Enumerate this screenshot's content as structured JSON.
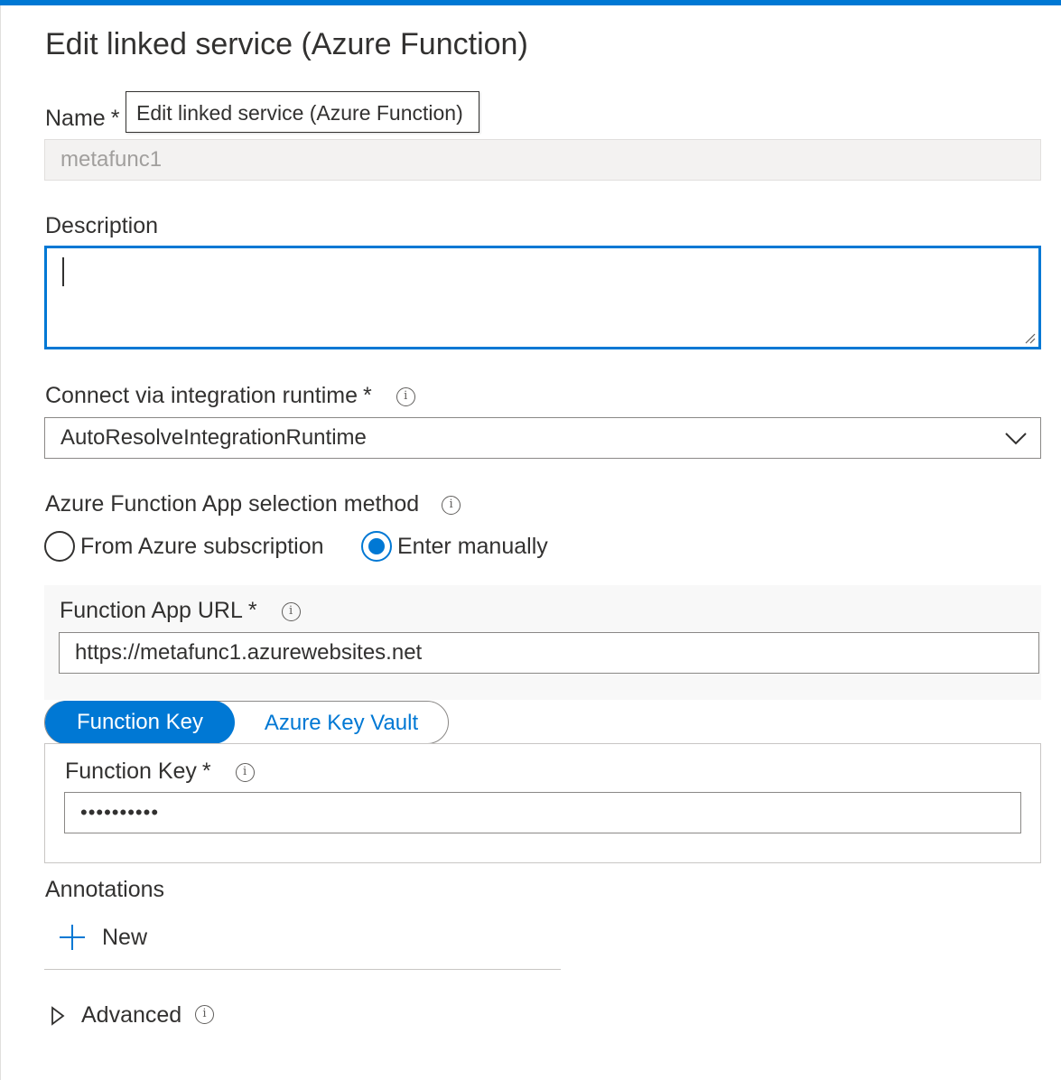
{
  "dialog": {
    "title": "Edit linked service (Azure Function)",
    "tooltip": "Edit linked service (Azure Function)"
  },
  "name": {
    "label": "Name",
    "required": "*",
    "value": "metafunc1"
  },
  "description": {
    "label": "Description",
    "value": ""
  },
  "runtime": {
    "label": "Connect via integration runtime",
    "required": "*",
    "selected": "AutoResolveIntegrationRuntime",
    "info_icon": "info-icon"
  },
  "selection_method": {
    "label": "Azure Function App selection method",
    "options": [
      {
        "label": "From Azure subscription",
        "checked": false
      },
      {
        "label": "Enter manually",
        "checked": true
      }
    ]
  },
  "function_app_url": {
    "label": "Function App URL",
    "required": "*",
    "value": "https://metafunc1.azurewebsites.net"
  },
  "auth_toggle": {
    "options": [
      "Function Key",
      "Azure Key Vault"
    ],
    "selected": "Function Key"
  },
  "function_key": {
    "label": "Function Key",
    "required": "*",
    "value": "••••••••••"
  },
  "annotations": {
    "label": "Annotations",
    "new_label": "New"
  },
  "advanced": {
    "label": "Advanced"
  },
  "colors": {
    "accent": "#0078d4",
    "text": "#323130",
    "border": "#8a8886"
  }
}
